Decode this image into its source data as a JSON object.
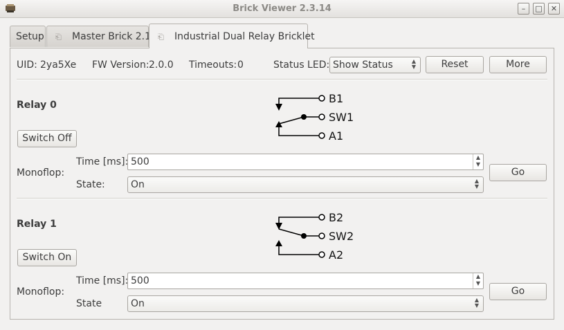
{
  "window": {
    "title": "Brick Viewer 2.3.14",
    "minimize_icon": "minimize-icon",
    "maximize_icon": "maximize-icon",
    "close_icon": "close-icon"
  },
  "tabs": [
    {
      "label": "Setup",
      "active": false
    },
    {
      "label": "Master Brick 2.1",
      "active": false,
      "icon": "undock-icon"
    },
    {
      "label": "Industrial Dual Relay Bricklet",
      "active": true,
      "icon": "undock-icon"
    }
  ],
  "info": {
    "uid_label": "UID:",
    "uid_value": "2ya5Xe",
    "fw_label": "FW Version:",
    "fw_value": "2.0.0",
    "timeouts_label": "Timeouts:",
    "timeouts_value": "0",
    "status_led_label": "Status LED:",
    "status_led_value": "Show Status",
    "reset_label": "Reset",
    "more_label": "More"
  },
  "relays": [
    {
      "title": "Relay 0",
      "switch_label": "Switch Off",
      "monoflop_label": "Monoflop:",
      "time_label": "Time [ms]:",
      "time_value": "500",
      "state_label": "State:",
      "state_value": "On",
      "go_label": "Go",
      "diagram": {
        "b": "B1",
        "sw": "SW1",
        "a": "A1",
        "position": "A"
      }
    },
    {
      "title": "Relay 1",
      "switch_label": "Switch On",
      "monoflop_label": "Monoflop:",
      "time_label": "Time [ms]:",
      "time_value": "500",
      "state_label": "State",
      "state_value": "On",
      "go_label": "Go",
      "diagram": {
        "b": "B2",
        "sw": "SW2",
        "a": "A2",
        "position": "B"
      }
    }
  ]
}
